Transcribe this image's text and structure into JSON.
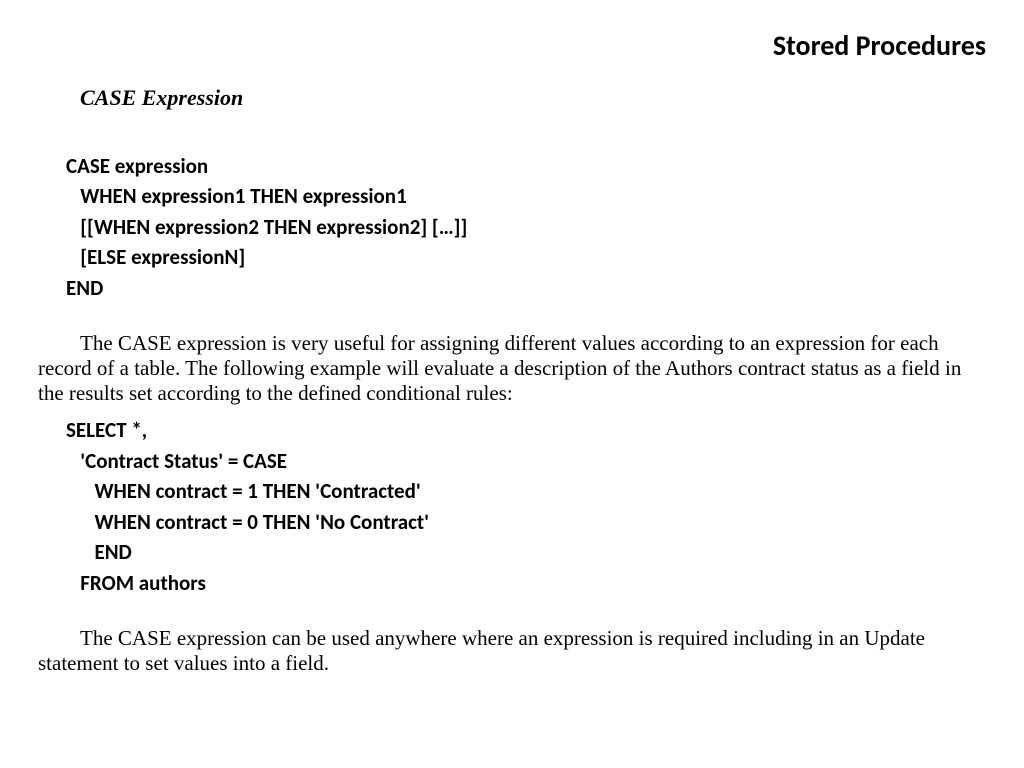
{
  "title": "Stored Procedures",
  "heading": "CASE Expression",
  "syntax": {
    "l1": "CASE expression",
    "l2": "   WHEN expression1 THEN expression1",
    "l3": "   [[WHEN expression2 THEN expression2] […]]",
    "l4": "   [ELSE expressionN]",
    "l5": "END"
  },
  "para1": "The CASE expression is very useful for assigning different values according to an expression for each record of a table. The following example will evaluate a description of the Authors contract status as a field in the results set according to the defined conditional rules:",
  "example": {
    "l1": "SELECT *,",
    "l2": "   'Contract Status' = CASE",
    "l3": "      WHEN contract = 1 THEN 'Contracted'",
    "l4": "      WHEN contract = 0 THEN 'No Contract'",
    "l5": "      END",
    "l6": "   FROM authors"
  },
  "para2": "The CASE expression can be used anywhere where an expression is required including in an Update statement to set values into a field."
}
